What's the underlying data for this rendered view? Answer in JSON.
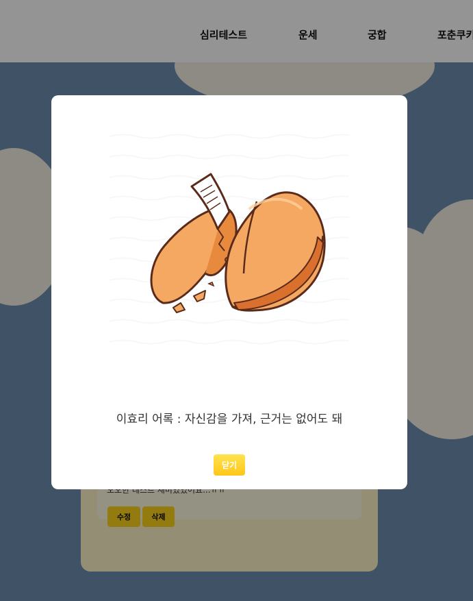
{
  "nav": {
    "items": [
      "심리테스트",
      "운세",
      "궁합",
      "포춘쿠키"
    ]
  },
  "card": {
    "text": "오오한 테스트 재미있었어요...ㅠㅠ",
    "edit_label": "수정",
    "delete_label": "삭제"
  },
  "modal": {
    "message": "이효리 어록 : 자신감을 가져, 근거는 없어도 돼",
    "close_label": "닫기",
    "illustration": "fortune-cookie"
  },
  "colors": {
    "accent": "#ffd51a",
    "background": "#6f8fb0",
    "cookie": "#f4a862",
    "cookie_outline": "#5a2a1a"
  }
}
